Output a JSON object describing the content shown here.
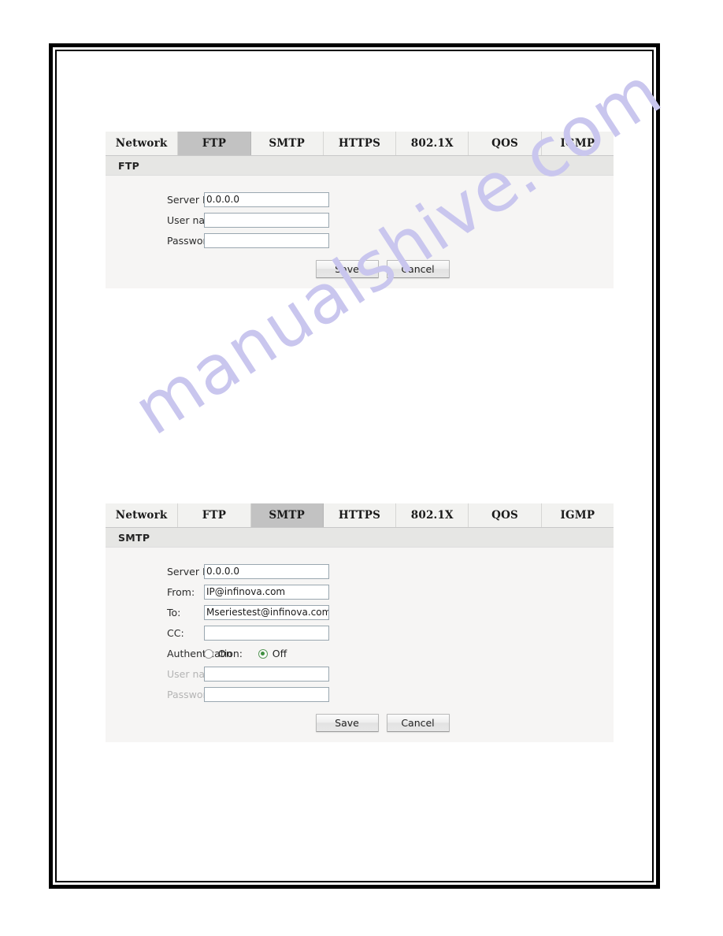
{
  "document": {
    "watermark": "manualshive.com"
  },
  "panels": [
    {
      "id": "ftp",
      "tabs": [
        {
          "label": "Network",
          "active": false
        },
        {
          "label": "FTP",
          "active": true
        },
        {
          "label": "SMTP",
          "active": false
        },
        {
          "label": "HTTPS",
          "active": false
        },
        {
          "label": "802.1X",
          "active": false
        },
        {
          "label": "QOS",
          "active": false
        },
        {
          "label": "IGMP",
          "active": false
        }
      ],
      "section_title": "FTP",
      "fields": [
        {
          "label": "Server IP:",
          "value": "0.0.0.0",
          "placeholder": "",
          "disabled": false
        },
        {
          "label": "User name:",
          "value": "",
          "placeholder": "",
          "disabled": false
        },
        {
          "label": "Password:",
          "value": "",
          "placeholder": "",
          "disabled": false
        }
      ],
      "buttons": [
        {
          "label": "Save"
        },
        {
          "label": "Cancel"
        }
      ]
    },
    {
      "id": "smtp",
      "tabs": [
        {
          "label": "Network",
          "active": false
        },
        {
          "label": "FTP",
          "active": false
        },
        {
          "label": "SMTP",
          "active": true
        },
        {
          "label": "HTTPS",
          "active": false
        },
        {
          "label": "802.1X",
          "active": false
        },
        {
          "label": "QOS",
          "active": false
        },
        {
          "label": "IGMP",
          "active": false
        }
      ],
      "section_title": "SMTP",
      "fields": [
        {
          "label": "Server IP:",
          "value": "0.0.0.0",
          "placeholder": "",
          "disabled": false
        },
        {
          "label": "From:",
          "value": "IP@infinova.com",
          "placeholder": "",
          "disabled": false
        },
        {
          "label": "To:",
          "value": "Mseriestest@infinova.com",
          "placeholder": "",
          "disabled": false
        },
        {
          "label": "CC:",
          "value": "",
          "placeholder": "",
          "disabled": false
        }
      ],
      "authentication": {
        "label": "Authentication:",
        "options": [
          {
            "label": "On",
            "selected": false
          },
          {
            "label": "Off",
            "selected": true
          }
        ]
      },
      "auth_fields": [
        {
          "label": "User name:",
          "value": "",
          "placeholder": "",
          "disabled": true
        },
        {
          "label": "Password:",
          "value": "",
          "placeholder": "",
          "disabled": true
        }
      ],
      "buttons": [
        {
          "label": "Save"
        },
        {
          "label": "Cancel"
        }
      ]
    }
  ]
}
